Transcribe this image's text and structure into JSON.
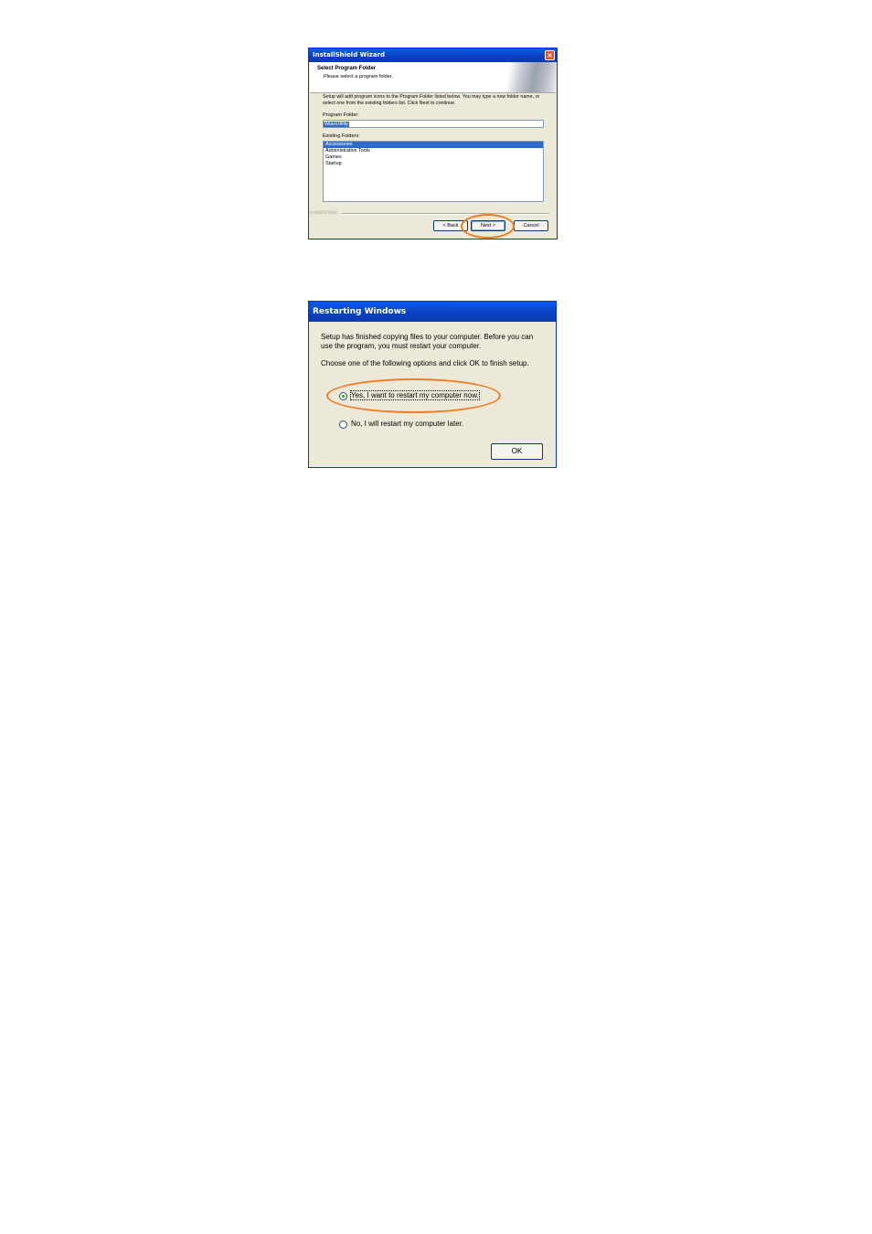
{
  "wizard": {
    "title": "InstallShield Wizard",
    "close_glyph": "×",
    "header_title": "Select Program Folder",
    "header_subtitle": "Please select a program folder.",
    "description": "Setup will add program icons to the Program Folder listed below. You may type a new folder name, or select one from the existing folders list. Click Next to continue.",
    "program_folder_label": "Program Folder:",
    "program_folder_value": "WlanUtility",
    "existing_folders_label": "Existing Folders:",
    "existing_folders": [
      "Accessories",
      "Administrative Tools",
      "Games",
      "Startup"
    ],
    "selected_folder": "Accessories",
    "brand": "InstallShield",
    "back_label": "< Back",
    "next_label": "Next >",
    "cancel_label": "Cancel",
    "highlight_color": "#f07b21"
  },
  "restart": {
    "title": "Restarting Windows",
    "message": "Setup has finished copying files to your computer.  Before you can use the program, you must restart your computer.",
    "instruction": "Choose one of the following options and click OK to finish setup.",
    "option_yes": "Yes, I want to restart my computer now.",
    "option_no": "No, I will restart my computer later.",
    "selected_option": "option_yes",
    "ok_label": "OK",
    "highlight_color": "#f07b21"
  }
}
